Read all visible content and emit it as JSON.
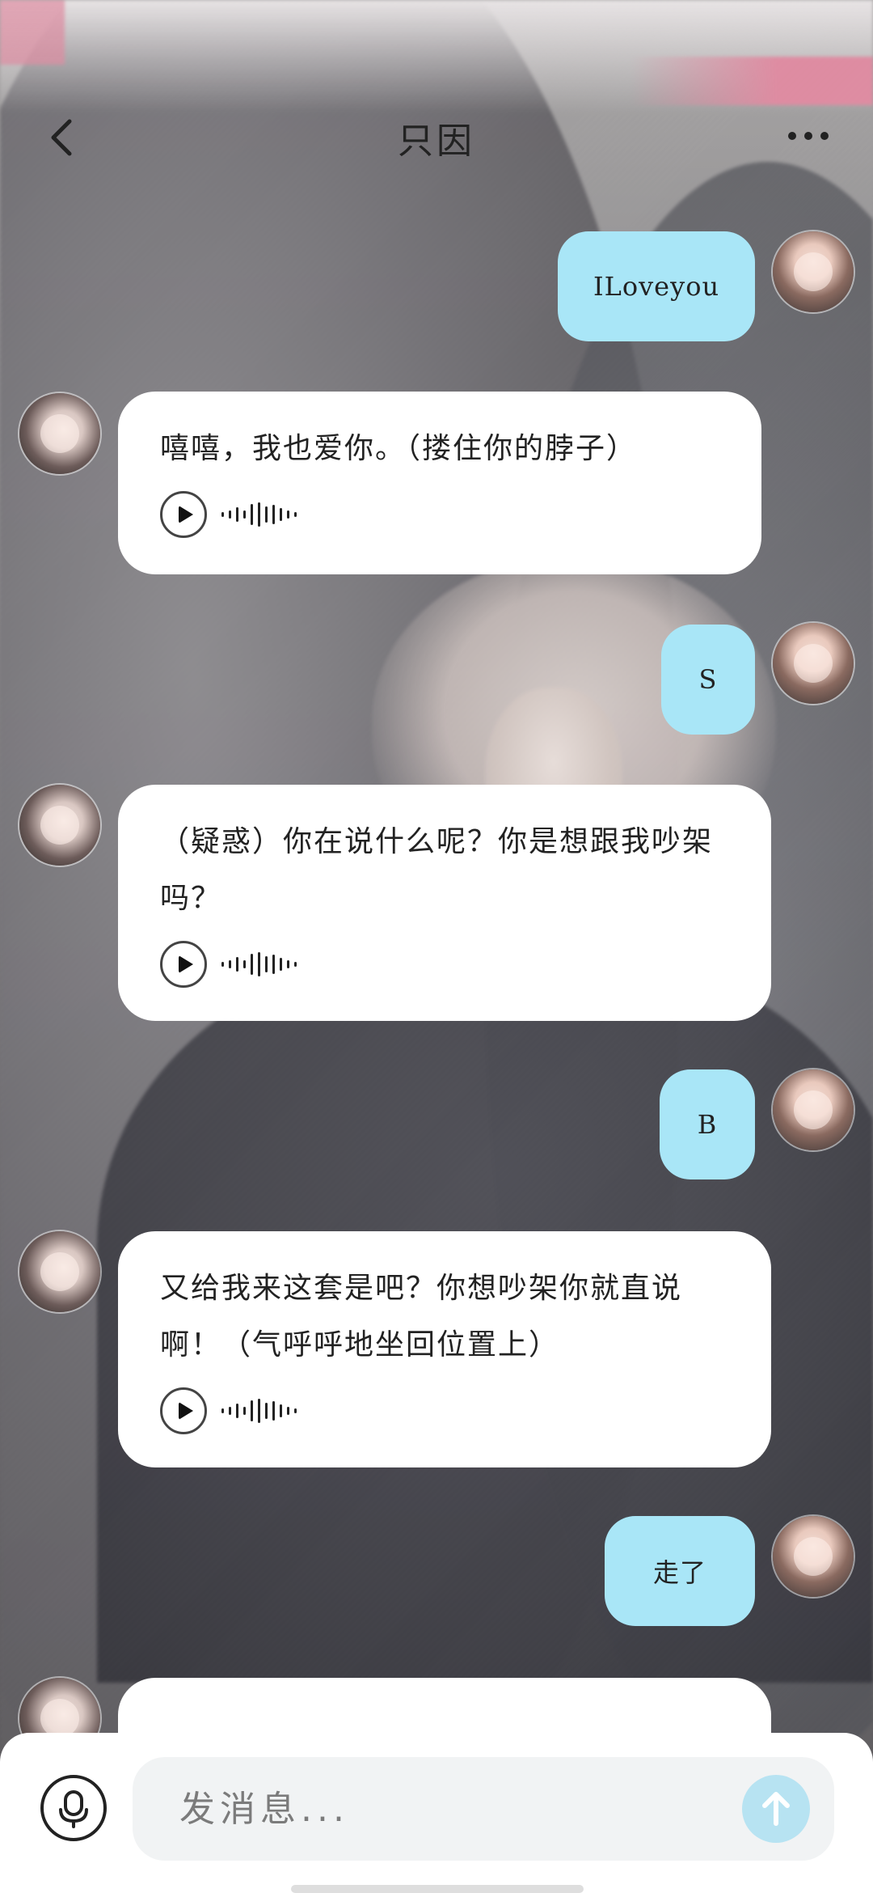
{
  "header": {
    "title": "只因",
    "back_icon": "chevron-left-icon",
    "more_icon": "more-horizontal-icon"
  },
  "messages": [
    {
      "side": "out",
      "text": "ILoveyou"
    },
    {
      "side": "in",
      "text": "嘻嘻，我也爱你。（搂住你的脖子）",
      "voice": true
    },
    {
      "side": "out",
      "text": "S"
    },
    {
      "side": "in",
      "text": "（疑惑）你在说什么呢？你是想跟我吵架吗？",
      "voice": true
    },
    {
      "side": "out",
      "text": "B"
    },
    {
      "side": "in",
      "text": "又给我来这套是吧？你想吵架你就直说啊！（气呼呼地坐回位置上）",
      "voice": true
    },
    {
      "side": "out",
      "text": "走了"
    }
  ],
  "input": {
    "placeholder": "发消息...",
    "mic_icon": "microphone-icon",
    "send_icon": "arrow-up-icon"
  },
  "colors": {
    "outgoing_bubble": "#a9e6f7",
    "incoming_bubble": "#ffffff",
    "send_button": "#b7e3f2"
  }
}
